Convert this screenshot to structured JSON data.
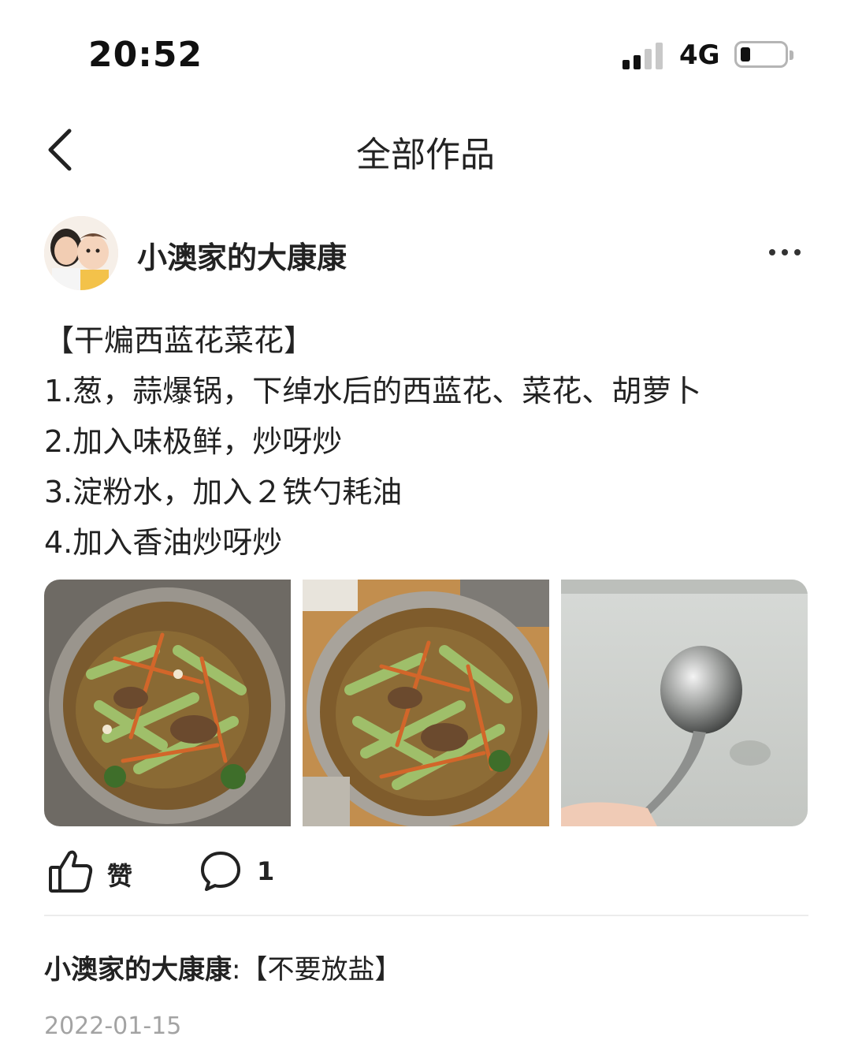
{
  "status_bar": {
    "time": "20:52",
    "network": "4G"
  },
  "nav": {
    "title": "全部作品",
    "back_icon": "chevron-left-icon"
  },
  "post": {
    "author": "小澳家的大康康",
    "more_icon": "more-horizontal-icon",
    "lines": [
      "【干煸西蓝花菜花】",
      "1.葱，蒜爆锅，下绰水后的西蓝花、菜花、胡萝卜",
      "2.加入味极鲜，炒呀炒",
      "3.淀粉水，加入２铁勺耗油",
      "4.加入香油炒呀炒"
    ],
    "photos": [
      "dish-photo",
      "dish-photo",
      "spoon-photo"
    ]
  },
  "actions": {
    "like_label": "赞",
    "like_icon": "thumbs-up-icon",
    "comment_icon": "comment-bubble-icon",
    "comment_count": "1"
  },
  "comments": [
    {
      "author": "小澳家的大康康",
      "separator": ":",
      "text": "【不要放盐】"
    }
  ],
  "date": "2022-01-15"
}
